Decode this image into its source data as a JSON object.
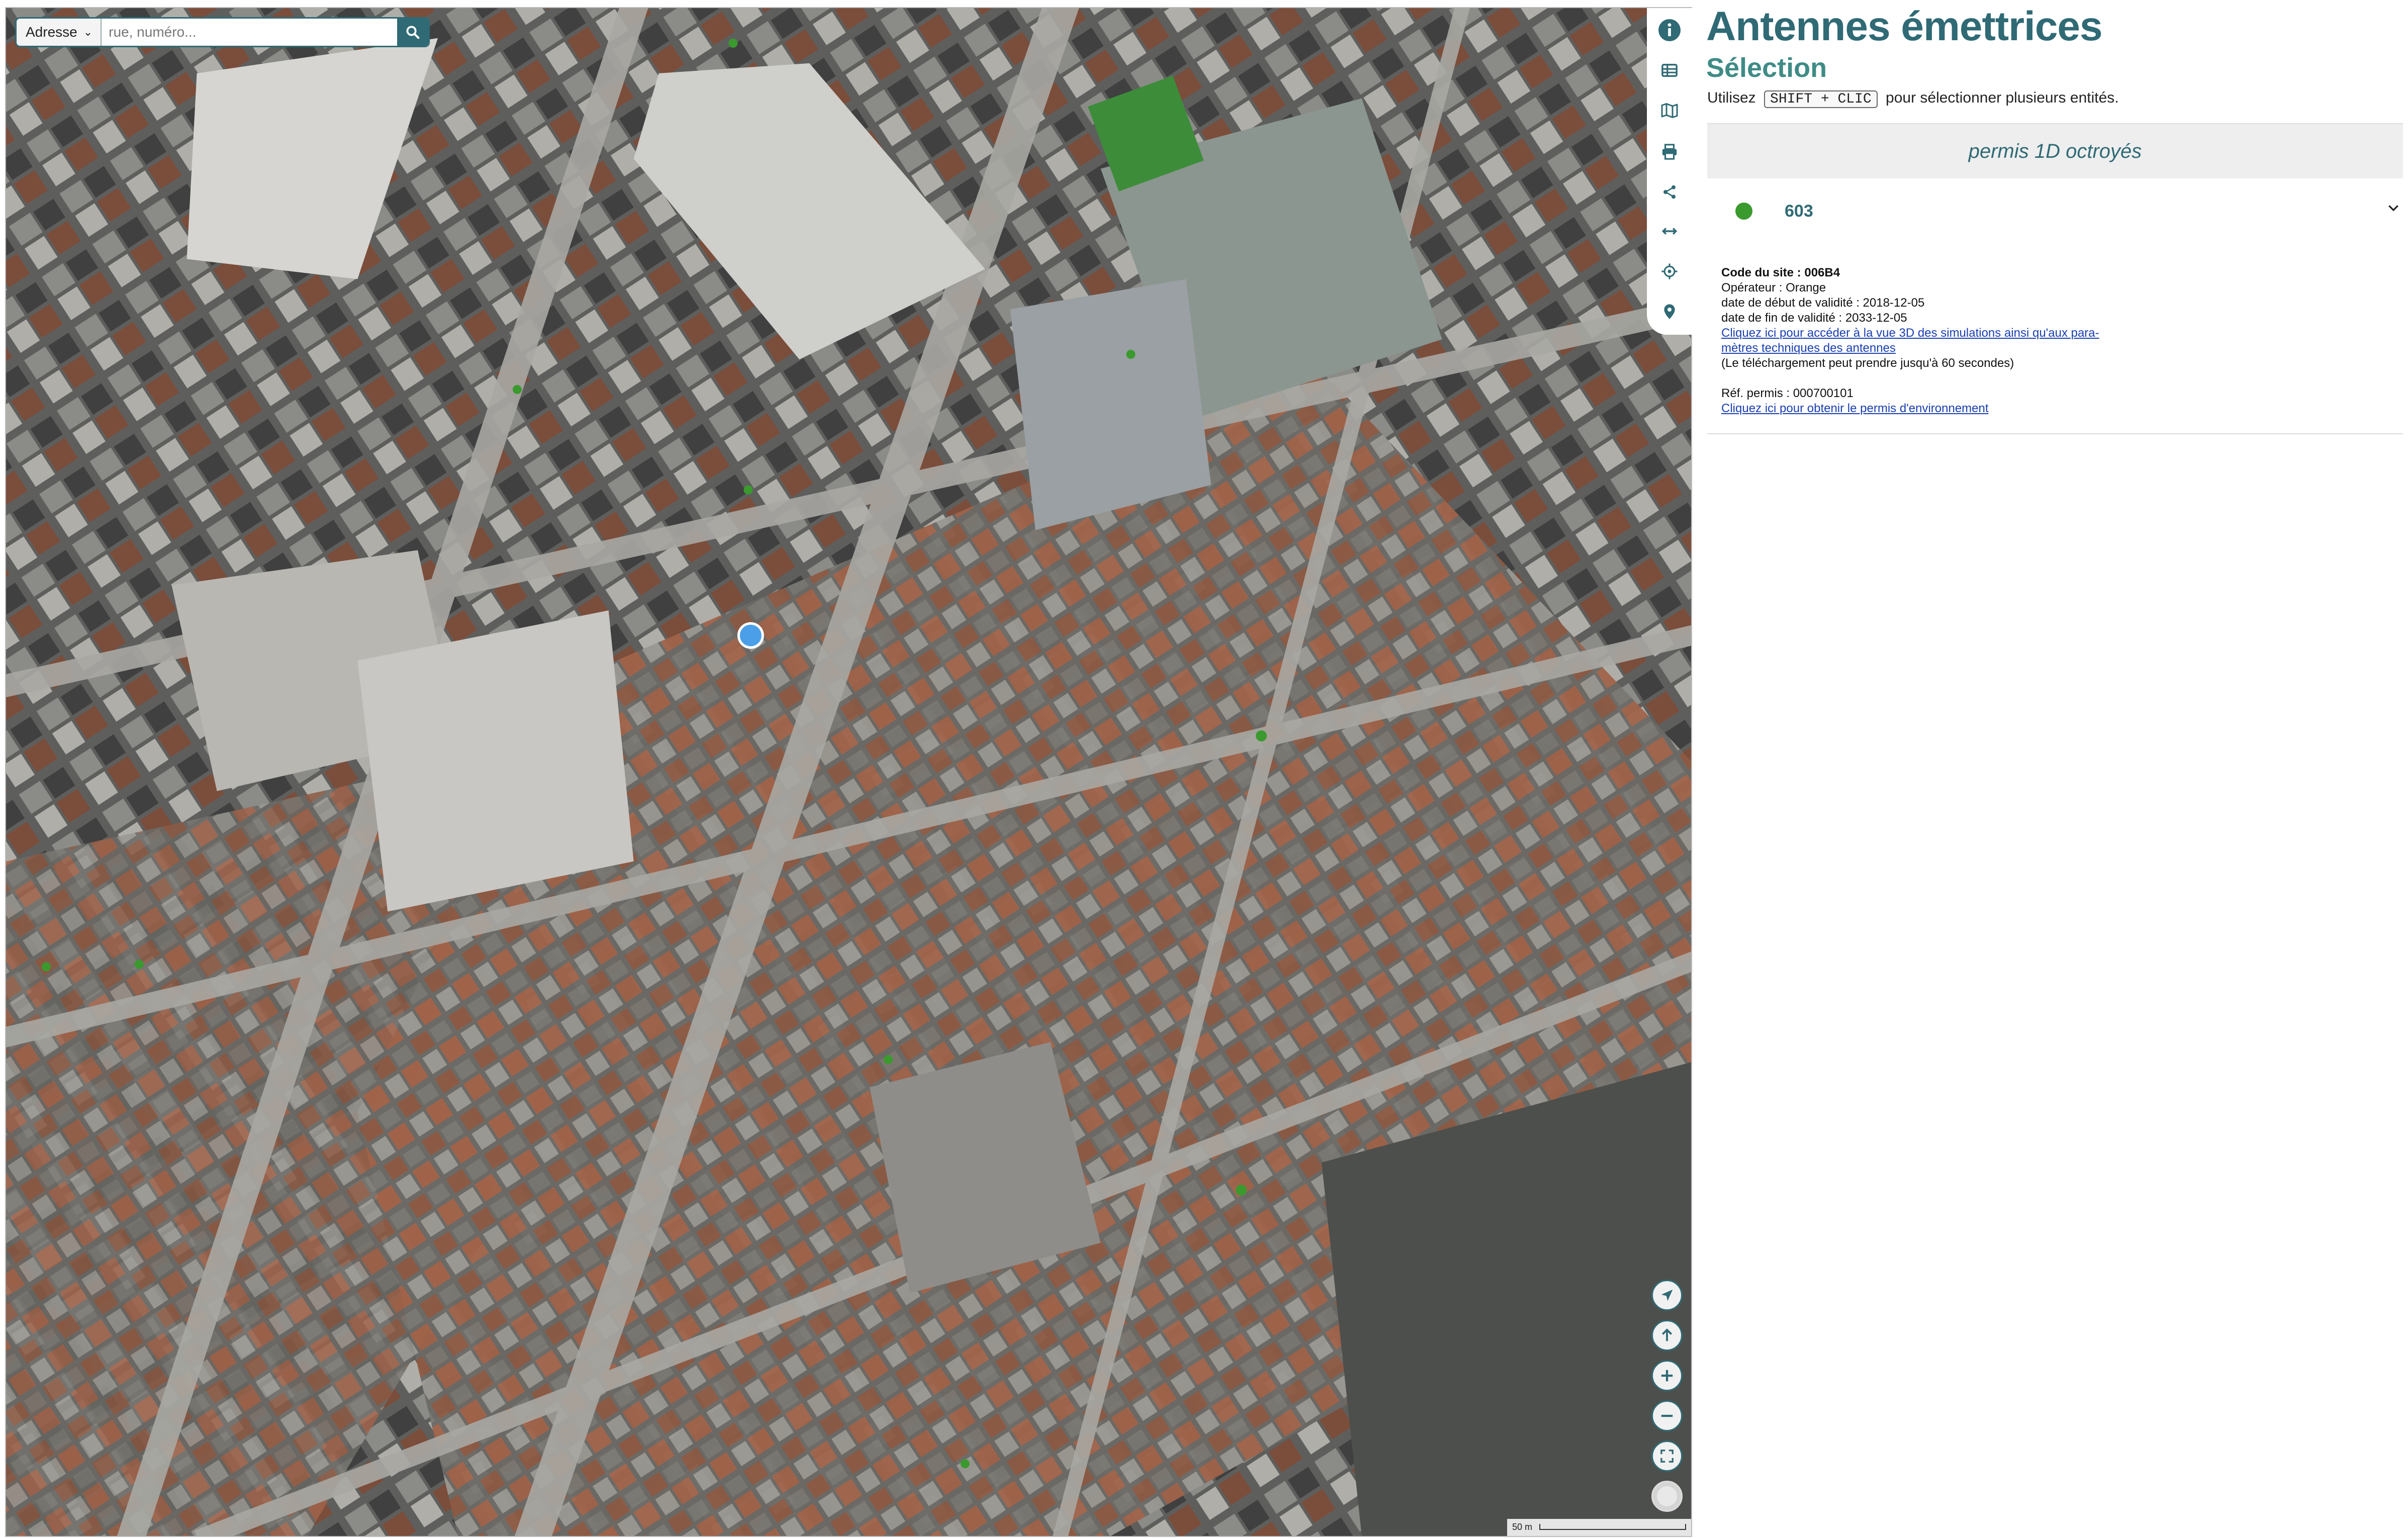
{
  "search": {
    "type_label": "Adresse",
    "placeholder": "rue, numéro..."
  },
  "toolbar": {
    "items": [
      "info-icon",
      "table-icon",
      "map-icon",
      "print-icon",
      "share-icon",
      "measure-icon",
      "locate-target-icon",
      "pin-icon"
    ]
  },
  "map_controls": [
    "navigate-icon",
    "north-arrow-icon",
    "zoom-in-icon",
    "zoom-out-icon",
    "fullscreen-icon",
    "basemap-icon"
  ],
  "scale_label": "50 m",
  "panel": {
    "title": "Antennes émettrices",
    "subtitle": "Sélection",
    "hint_before": "Utilisez",
    "hint_key": "SHIFT + CLIC",
    "hint_after": "pour sélectionner plusieurs entités.",
    "section": "permis 1D octroyés",
    "item_number": "603",
    "details": {
      "site_code": "Code du site : 006B4",
      "operator": "Opérateur : Orange",
      "start": "date de début de validité : 2018-12-05",
      "end": "date de fin de validité : 2033-12-05",
      "link_3d_line1": "Cliquez ici pour accéder à la vue 3D des simulations ainsi qu'aux para-",
      "link_3d_line2": "mètres techniques des antennes",
      "download_note": "(Le téléchargement peut prendre jusqu'à 60 secondes)",
      "permit_ref": "Réf. permis : 000700101",
      "link_permit": "Cliquez ici pour obtenir le permis d'environnement"
    }
  },
  "colors": {
    "accent": "#2f6a75",
    "subtitle": "#3f8b86",
    "antenna_green": "#3a9a2e",
    "selection_blue": "#4a9fe8"
  }
}
